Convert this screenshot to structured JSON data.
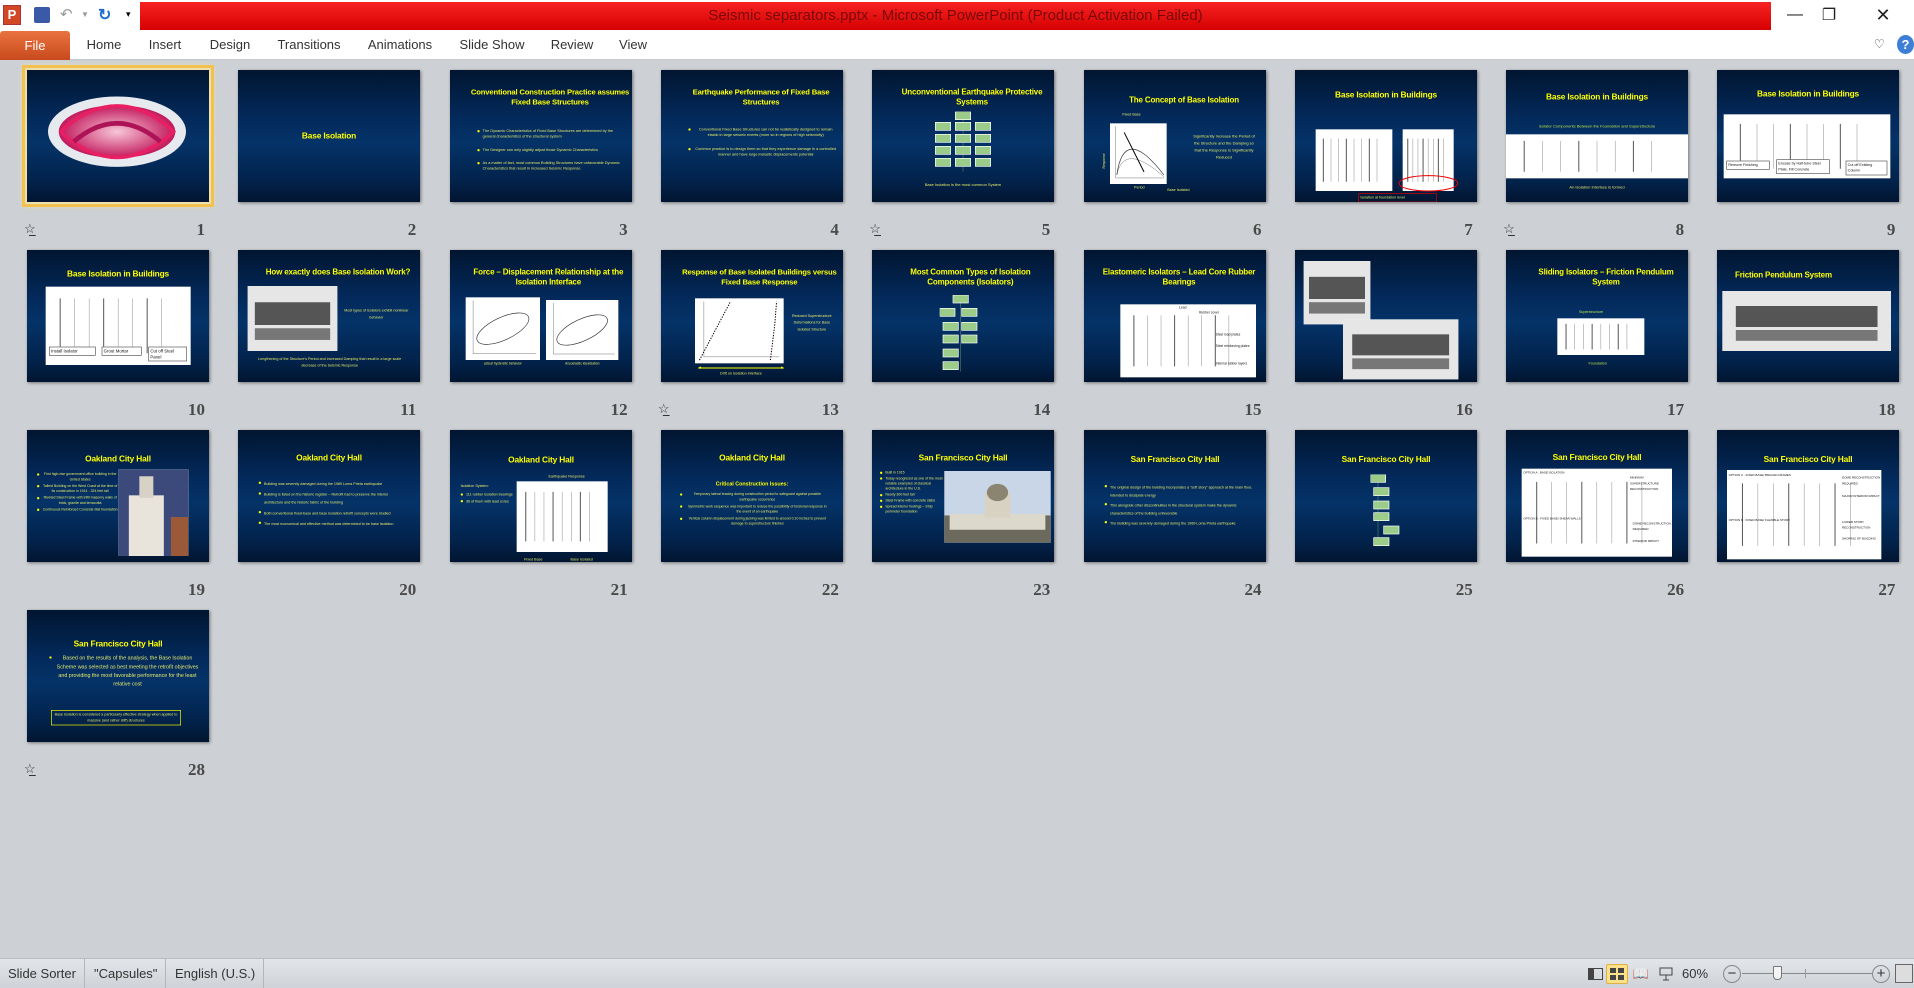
{
  "app": {
    "title": "Seismic separators.pptx - Microsoft PowerPoint (Product Activation Failed)",
    "file_tab": "File",
    "tabs": [
      "Home",
      "Insert",
      "Design",
      "Transitions",
      "Animations",
      "Slide Show",
      "Review",
      "View"
    ],
    "title_bar_color": "#e30b0b",
    "file_tab_color": "#d9582a"
  },
  "slides": [
    {
      "number": "1",
      "title": "",
      "bullets": [],
      "texts": [],
      "animation": true,
      "selected": true
    },
    {
      "number": "2",
      "title": "Base Isolation",
      "bullets": [],
      "texts": []
    },
    {
      "number": "3",
      "title": "Conventional Construction Practice assumes Fixed Base Structures",
      "bullets": [
        "The Dynamic Characteristics of Fixed Base Structures are determined by the general characteristics of the structural system",
        "The Designer can only slightly adjust those Dynamic Characteristics",
        "As a matter of fact, most common Building Structures have unfavorable Dynamic Characteristics that result in increased Seismic Response"
      ],
      "texts": []
    },
    {
      "number": "4",
      "title": "Earthquake Performance of Fixed Base Structures",
      "bullets": [
        "Conventional Fixed Base Structures can not be realistically designed to remain elastic in large seismic events (more so in regions of high seismicity)",
        "Common practice is to design them so that they experience damage in a controlled manner and have large inelastic displacements potential"
      ],
      "texts": []
    },
    {
      "number": "5",
      "title": "Unconventional Earthquake Protective Systems",
      "bullets": [],
      "texts": [
        "Base Isolation is the most common System"
      ],
      "animation": true
    },
    {
      "number": "6",
      "title": "The Concept of Base Isolation",
      "bullets": [],
      "texts": [
        "Significantly Increase the Period of the Structure and the Damping so that the Response is Significantly Reduced",
        "Fixed Base",
        "Period",
        "Base Isolated",
        "Response"
      ]
    },
    {
      "number": "7",
      "title": "Base Isolation in Buildings",
      "bullets": [],
      "texts": [
        "Isolation at foundation level"
      ]
    },
    {
      "number": "8",
      "title": "Base Isolation in Buildings",
      "bullets": [],
      "texts": [
        "Isolator Components Between the Foundation and Superstructure",
        "An Isolation Interface is formed"
      ],
      "animation": true
    },
    {
      "number": "9",
      "title": "Base Isolation in Buildings",
      "bullets": [],
      "texts": [
        "Remove Finishing",
        "Encase by Half-tube Steel Plate, Fill Concrete",
        "Cut off Existing Column"
      ]
    },
    {
      "number": "10",
      "title": "Base Isolation in Buildings",
      "bullets": [],
      "texts": [
        "Install Isolator",
        "Grout Mortar",
        "Cut off Steel Panel"
      ]
    },
    {
      "number": "11",
      "title": "How exactly does Base Isolation Work?",
      "bullets": [],
      "texts": [
        "Most types of isolators exhibit nonlinear behavior",
        "Lengthening of the Structure's Period and increased Damping that result in a large scale decrease of the Seismic Response"
      ]
    },
    {
      "number": "12",
      "title": "Force – Displacement Relationship at the Isolation Interface",
      "bullets": [],
      "texts": [
        "actual hysteretic behavior",
        "viscoelastic idealization"
      ]
    },
    {
      "number": "13",
      "title": "Response of Base Isolated Buildings versus Fixed Base Response",
      "bullets": [],
      "texts": [
        "Reduced Superstructure Deformations for Base Isolated Structure",
        "Drift on Isolation Interface"
      ],
      "animation": true
    },
    {
      "number": "14",
      "title": "Most Common Types of Isolation Components (Isolators)",
      "bullets": [],
      "texts": []
    },
    {
      "number": "15",
      "title": "Elastomeric Isolators – Lead Core Rubber Bearings",
      "bullets": [],
      "texts": [
        "Lead",
        "Rubber cover",
        "Steel load plates",
        "Steel reinforcing plates",
        "Internal rubber layers"
      ]
    },
    {
      "number": "16",
      "title": "",
      "bullets": [],
      "texts": []
    },
    {
      "number": "17",
      "title": "Sliding Isolators – Friction Pendulum System",
      "bullets": [],
      "texts": [
        "Superstructure",
        "Foundation"
      ]
    },
    {
      "number": "18",
      "title": "Friction Pendulum System",
      "bullets": [],
      "texts": []
    },
    {
      "number": "19",
      "title": "Oakland City Hall",
      "bullets": [
        "First high-rise government office building in the United States",
        "Tallest Building on the West Coast at the time of its construction in 1914 - 324 feet tall",
        "Riveted Steel Frame with infill masonry walls of brick, granite and terracotta",
        "Continuous Reinforced Concrete Mat foundation"
      ],
      "texts": []
    },
    {
      "number": "20",
      "title": "Oakland City Hall",
      "bullets": [
        "Building was severely damaged during the 1989 Loma Prieta earthquake",
        "Building is listed on the historic register – Retrofit had to preserve the interior architecture and the historic fabric of the building",
        "Both conventional fixed-base and base isolation retrofit concepts were studied",
        "The most economical and effective method was determined to be base isolation"
      ],
      "texts": []
    },
    {
      "number": "21",
      "title": "Oakland City Hall",
      "bullets": [
        "111 rubber isolation bearings",
        "36 of them with lead cores"
      ],
      "texts": [
        "Earthquake Response",
        "Isolation System:",
        "Fixed Base",
        "Base Isolated"
      ]
    },
    {
      "number": "22",
      "title": "Oakland City Hall",
      "bullets": [
        "Temporary lateral bracing during construction period to safeguard against possible earthquake occurrence",
        "Symmetric work sequence was important to reduce the possibility of torsional response in the event of an earthquake",
        "Vertical column displacement during jacking was limited to around 0.10 inches to prevent damage to superstructure finishes"
      ],
      "texts": [
        "Critical Construction Issues:"
      ]
    },
    {
      "number": "23",
      "title": "San Francisco City Hall",
      "bullets": [
        "Built in 1915",
        "Today recognized as one of the most notable examples of classical architecture in the U.S.",
        "Nearly 300 feet tall",
        "Steel Frame with concrete slabs",
        "Spread interior footings – Strip perimeter foundation"
      ],
      "texts": []
    },
    {
      "number": "24",
      "title": "San Francisco City Hall",
      "bullets": [
        "The original design of the building incorporates a \"soft story\" approach at the main floor, intended to dissipate energy",
        "This alongside other discontinuities in the structural system make the dynamic characteristics of the building unfavorable",
        "The Building was severely damaged during the 1989 Loma Prieta earthquake"
      ],
      "texts": []
    },
    {
      "number": "25",
      "title": "San Francisco City Hall",
      "bullets": [],
      "texts": []
    },
    {
      "number": "26",
      "title": "San Francisco City Hall",
      "bullets": [],
      "texts": [
        "OPTION A : BASE ISOLATION",
        "MINIMUM SUPERSTRUCTURE RECONSTRUCTION",
        "OPTION B : FIXED BASE/ SHEAR WALLS",
        "DOME RECONSTRUCTION REQUIRED",
        "INTERIOR IMPACT"
      ]
    },
    {
      "number": "27",
      "title": "San Francisco City Hall",
      "bullets": [],
      "texts": [
        "OPTION C : FIXED BASE/ BRACED FRAMES",
        "DOME RECONSTRUCTION REQUIRED",
        "MAJOR INTERIOR IMPACT",
        "OPTION D : FIXED BASE/ FLEXIBLE STORY",
        "LOWER STORY RECONSTRUCTION",
        "SHORING OF BUILDING"
      ]
    },
    {
      "number": "28",
      "title": "San Francisco City Hall",
      "bullets": [
        "Based on the results of the analysis, the Base Isolation Scheme was selected as best meeting the retrofit objectives and providing the most favorable performance for the least relative cost"
      ],
      "texts": [
        "Base Isolation is considered a particularly effective strategy when applied to massive (and rather stiff) structures"
      ],
      "animation": true
    }
  ],
  "status": {
    "view": "Slide Sorter",
    "theme": "\"Capsules\"",
    "language": "English (U.S.)",
    "zoom": "60%",
    "zoom_percent": 60
  },
  "colors": {
    "slide_title": "#ffff00",
    "slide_body": "#e4e86a",
    "selection": "#f2c14e"
  }
}
